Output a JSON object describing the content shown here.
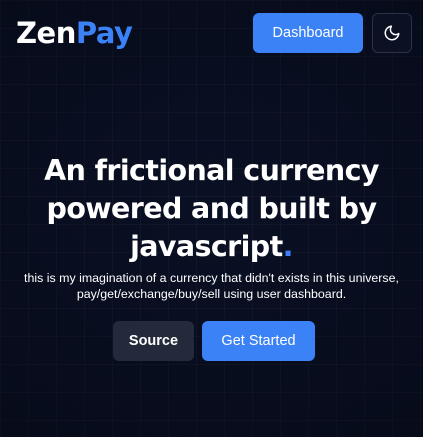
{
  "header": {
    "logo_part1": "Zen",
    "logo_part2": "Pay",
    "dashboard_label": "Dashboard",
    "theme_icon": "moon-icon"
  },
  "hero": {
    "title": "An frictional currency powered and built by javascript",
    "title_dot": ".",
    "subtitle": "this is my imagination of a currency that didn't exists in this universe, pay/get/exchange/buy/sell using user dashboard."
  },
  "actions": {
    "source_label": "Source",
    "get_started_label": "Get Started"
  },
  "colors": {
    "accent": "#3b82f6",
    "background": "#0a1024",
    "secondary_button": "#222a3b"
  }
}
